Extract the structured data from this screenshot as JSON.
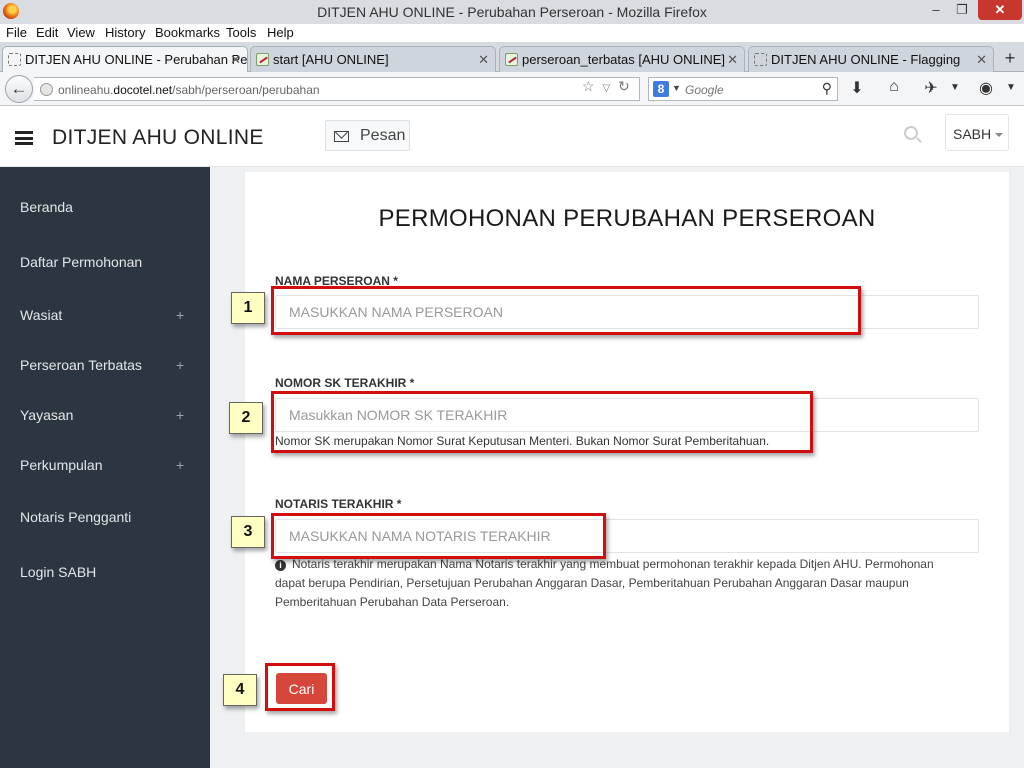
{
  "browser": {
    "window_title": "DITJEN AHU ONLINE - Perubahan Perseroan - Mozilla Firefox",
    "window_controls": {
      "minimize": "–",
      "maximize": "❐",
      "close": "✕"
    },
    "menu": [
      "File",
      "Edit",
      "View",
      "History",
      "Bookmarks",
      "Tools",
      "Help"
    ],
    "tabs": [
      {
        "label": "DITJEN AHU ONLINE - Perubahan Pe...",
        "icon": "blank-page-icon",
        "active": true
      },
      {
        "label": "start [AHU ONLINE]",
        "icon": "wiki-icon",
        "active": false
      },
      {
        "label": "perseroan_terbatas [AHU ONLINE]",
        "icon": "wiki-icon",
        "active": false
      },
      {
        "label": "DITJEN AHU ONLINE - Flagging",
        "icon": "blank-page-icon",
        "active": false
      }
    ],
    "new_tab": "+",
    "url": {
      "prefix": "onlineahu.",
      "domain": "docotel.net",
      "path": "/sabh/perseroan/perubahan"
    },
    "search_engine_placeholder": "Google"
  },
  "app": {
    "brand": "DITJEN AHU ONLINE",
    "pesan_label": "Pesan",
    "user_label": "SABH"
  },
  "sidebar": {
    "items": [
      {
        "label": "Beranda",
        "expandable": false
      },
      {
        "label": "Daftar Permohonan",
        "expandable": false
      },
      {
        "label": "Wasiat",
        "expandable": true
      },
      {
        "label": "Perseroan Terbatas",
        "expandable": true
      },
      {
        "label": "Yayasan",
        "expandable": true
      },
      {
        "label": "Perkumpulan",
        "expandable": true
      },
      {
        "label": "Notaris Pengganti",
        "expandable": false
      },
      {
        "label": "Login SABH",
        "expandable": false
      }
    ],
    "plus_symbol": "+"
  },
  "form": {
    "title": "PERMOHONAN PERUBAHAN PERSEROAN",
    "nama": {
      "label": "NAMA PERSEROAN *",
      "placeholder": "MASUKKAN NAMA PERSEROAN",
      "value": ""
    },
    "nomor_sk": {
      "label": "NOMOR SK TERAKHIR *",
      "placeholder": "Masukkan NOMOR SK TERAKHIR",
      "value": "",
      "help": "Nomor SK merupakan Nomor Surat Keputusan Menteri. Bukan Nomor Surat Pemberitahuan."
    },
    "notaris": {
      "label": "NOTARIS TERAKHIR *",
      "placeholder": "MASUKKAN NAMA NOTARIS TERAKHIR",
      "value": "",
      "help": "Notaris terakhir merupakan Nama Notaris terakhir yang membuat permohonan terakhir kepada Ditjen AHU. Permohonan dapat berupa Pendirian, Persetujuan Perubahan Anggaran Dasar, Pemberitahuan Perubahan Anggaran Dasar maupun Pemberitahuan Perubahan Data Perseroan."
    },
    "submit_label": "Cari"
  },
  "annotations": {
    "steps": [
      "1",
      "2",
      "3",
      "4"
    ],
    "highlight_color": "#d10f0f",
    "badge_color": "#ffffc4"
  },
  "colors": {
    "sidebar_bg": "#2b3640",
    "content_bg": "#eef0f2",
    "submit_button": "#d6463b"
  }
}
